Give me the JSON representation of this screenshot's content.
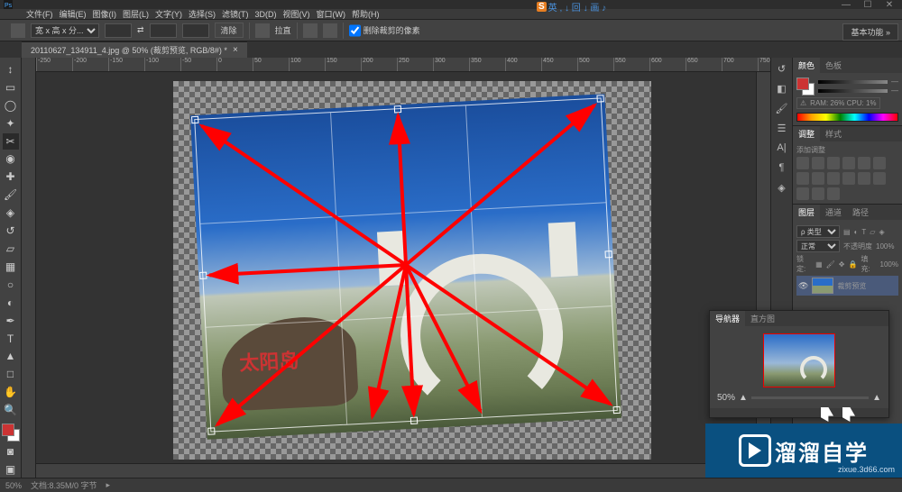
{
  "menu": {
    "items": [
      "文件(F)",
      "编辑(E)",
      "图像(I)",
      "图层(L)",
      "文字(Y)",
      "选择(S)",
      "滤镜(T)",
      "3D(D)",
      "视图(V)",
      "窗口(W)",
      "帮助(H)"
    ]
  },
  "ime": {
    "s": "S",
    "rest": "英 , ↓ 回 ↓ 画 ♪"
  },
  "options": {
    "crop_preset": "宽 x 高 x 分...",
    "btn_clear": "清除",
    "btn_straight": "拉直",
    "checkbox_label": "删除裁剪的像素"
  },
  "workspace_label": "基本功能",
  "document": {
    "tab_title": "20110627_134911_4.jpg @ 50% (裁剪预览, RGB/8#) *"
  },
  "ruler_start": -250,
  "ruler_step": 50,
  "color_panel": {
    "tab1": "颜色",
    "tab2": "色板",
    "ram_label": "RAM: 26%   CPU: 1%"
  },
  "adjust_panel": {
    "tab1": "调整",
    "tab2": "样式",
    "subtitle": "添加调整"
  },
  "layers_panel": {
    "tab1": "图层",
    "tab2": "通道",
    "tab3": "路径",
    "blend": "正常",
    "opacity_label": "不透明度",
    "opacity_value": "100%",
    "lock_label": "锁定:",
    "fill_label": "填充:",
    "fill_value": "100%",
    "layer_name": "裁剪预览"
  },
  "navigator": {
    "tab1": "导航器",
    "tab2": "直方图",
    "zoom": "50%"
  },
  "status": {
    "zoom": "50%",
    "doc": "文档:8.35M/0 字节"
  },
  "watermark": {
    "main": "溜溜自学",
    "sub": "zixue.3d66.com"
  },
  "rock_text": "太阳岛"
}
